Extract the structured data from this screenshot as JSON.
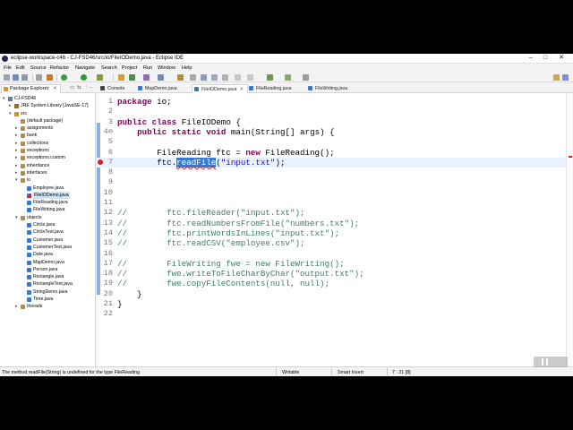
{
  "window": {
    "title": "eclipse-workspace-c46 - CJ-FSD46/src/io/FileIODemo.java - Eclipse IDE",
    "minimize": "–",
    "maximize": "□",
    "close": "✕"
  },
  "menu": [
    "File",
    "Edit",
    "Source",
    "Refactor",
    "Navigate",
    "Search",
    "Project",
    "Run",
    "Window",
    "Help"
  ],
  "explorer": {
    "tab_label": "Package Explorer",
    "items": [
      {
        "label": "CJ-FSD46",
        "level": 0,
        "kind": "project",
        "expanded": true
      },
      {
        "label": "JRE System Library [JavaSE-17]",
        "level": 1,
        "kind": "lib",
        "expanded": false
      },
      {
        "label": "src",
        "level": 1,
        "kind": "src",
        "expanded": true
      },
      {
        "label": "(default package)",
        "level": 2,
        "kind": "pkg",
        "expanded": false
      },
      {
        "label": "assignments",
        "level": 2,
        "kind": "pkg",
        "expanded": false
      },
      {
        "label": "bank",
        "level": 2,
        "kind": "pkg",
        "expanded": false
      },
      {
        "label": "collections",
        "level": 2,
        "kind": "pkg",
        "expanded": false
      },
      {
        "label": "exceptions",
        "level": 2,
        "kind": "pkg",
        "expanded": false
      },
      {
        "label": "exceptions.custom",
        "level": 2,
        "kind": "pkg",
        "expanded": false
      },
      {
        "label": "inheritance",
        "level": 2,
        "kind": "pkg",
        "expanded": false
      },
      {
        "label": "interfaces",
        "level": 2,
        "kind": "pkg",
        "expanded": false
      },
      {
        "label": "io",
        "level": 2,
        "kind": "pkg",
        "expanded": true
      },
      {
        "label": "Employee.java",
        "level": 3,
        "kind": "java",
        "expanded": false
      },
      {
        "label": "FileIODemo.java",
        "level": 3,
        "kind": "java-err",
        "expanded": false,
        "selected": true
      },
      {
        "label": "FileReading.java",
        "level": 3,
        "kind": "java",
        "expanded": false
      },
      {
        "label": "FileWriting.java",
        "level": 3,
        "kind": "java",
        "expanded": false
      },
      {
        "label": "objects",
        "level": 2,
        "kind": "pkg",
        "expanded": true
      },
      {
        "label": "Circle.java",
        "level": 3,
        "kind": "java",
        "expanded": false
      },
      {
        "label": "CircleTest.java",
        "level": 3,
        "kind": "java",
        "expanded": false
      },
      {
        "label": "Customer.java",
        "level": 3,
        "kind": "java",
        "expanded": false
      },
      {
        "label": "CustomerTest.java",
        "level": 3,
        "kind": "java",
        "expanded": false
      },
      {
        "label": "Date.java",
        "level": 3,
        "kind": "java",
        "expanded": false
      },
      {
        "label": "MapDemo.java",
        "level": 3,
        "kind": "java",
        "expanded": false
      },
      {
        "label": "Person.java",
        "level": 3,
        "kind": "java",
        "expanded": false
      },
      {
        "label": "Rectangle.java",
        "level": 3,
        "kind": "java",
        "expanded": false
      },
      {
        "label": "RectangleTest.java",
        "level": 3,
        "kind": "java",
        "expanded": false
      },
      {
        "label": "StringDemo.java",
        "level": 3,
        "kind": "java",
        "expanded": false
      },
      {
        "label": "Time.java",
        "level": 3,
        "kind": "java",
        "expanded": false
      },
      {
        "label": "threads",
        "level": 2,
        "kind": "pkg",
        "expanded": false
      }
    ]
  },
  "editor_tabs": [
    {
      "label": "Console",
      "kind": "console",
      "active": false
    },
    {
      "label": "MapDemo.java",
      "kind": "java",
      "active": false
    },
    {
      "label": "FileIODemo.java",
      "kind": "java",
      "active": true
    },
    {
      "label": "FileReading.java",
      "kind": "java",
      "active": false
    },
    {
      "label": "FileWriting.java",
      "kind": "java",
      "active": false
    }
  ],
  "code_lines": [
    {
      "n": "1",
      "text": "package io;"
    },
    {
      "n": "2",
      "text": ""
    },
    {
      "n": "3",
      "text": "public class FileIODemo {"
    },
    {
      "n": "4⊖",
      "text": "    public static void main(String[] args) {"
    },
    {
      "n": "5",
      "text": ""
    },
    {
      "n": "6",
      "text": "        FileReading ftc = new FileReading();"
    },
    {
      "n": "7",
      "text": "        ftc.readFile(\"input.txt\");",
      "error": true,
      "current": true
    },
    {
      "n": "8",
      "text": ""
    },
    {
      "n": "9",
      "text": ""
    },
    {
      "n": "10",
      "text": ""
    },
    {
      "n": "11",
      "text": ""
    },
    {
      "n": "12",
      "text": "//        ftc.fileReader(\"input.txt\");",
      "comment": true
    },
    {
      "n": "13",
      "text": "//        ftc.readNumbersFromFile(\"numbers.txt\");",
      "comment": true
    },
    {
      "n": "14",
      "text": "//        ftc.printWordsInLines(\"input.txt\");",
      "comment": true
    },
    {
      "n": "15",
      "text": "//        ftc.readCSV(\"employee.csv\");",
      "comment": true
    },
    {
      "n": "16",
      "text": ""
    },
    {
      "n": "17",
      "text": "//        FileWriting fwe = new FileWriting();",
      "comment": true
    },
    {
      "n": "18",
      "text": "//        fwe.writeToFileCharByChar(\"output.txt\");",
      "comment": true
    },
    {
      "n": "19",
      "text": "//        fwe.copyFileContents(null, null);",
      "comment": true
    },
    {
      "n": "20",
      "text": "    }"
    },
    {
      "n": "21",
      "text": "}"
    },
    {
      "n": "22",
      "text": ""
    }
  ],
  "status": {
    "message": "The method readFile(String) is undefined for the type FileReading",
    "mode": "Writable",
    "insert": "Smart Insert",
    "position": "7 : 21 [8]"
  },
  "colors": {
    "keyword": "#7f0055",
    "comment": "#3f7f5f",
    "string": "#2a00ff",
    "error": "#e02020",
    "selection": "#cde3f7"
  }
}
